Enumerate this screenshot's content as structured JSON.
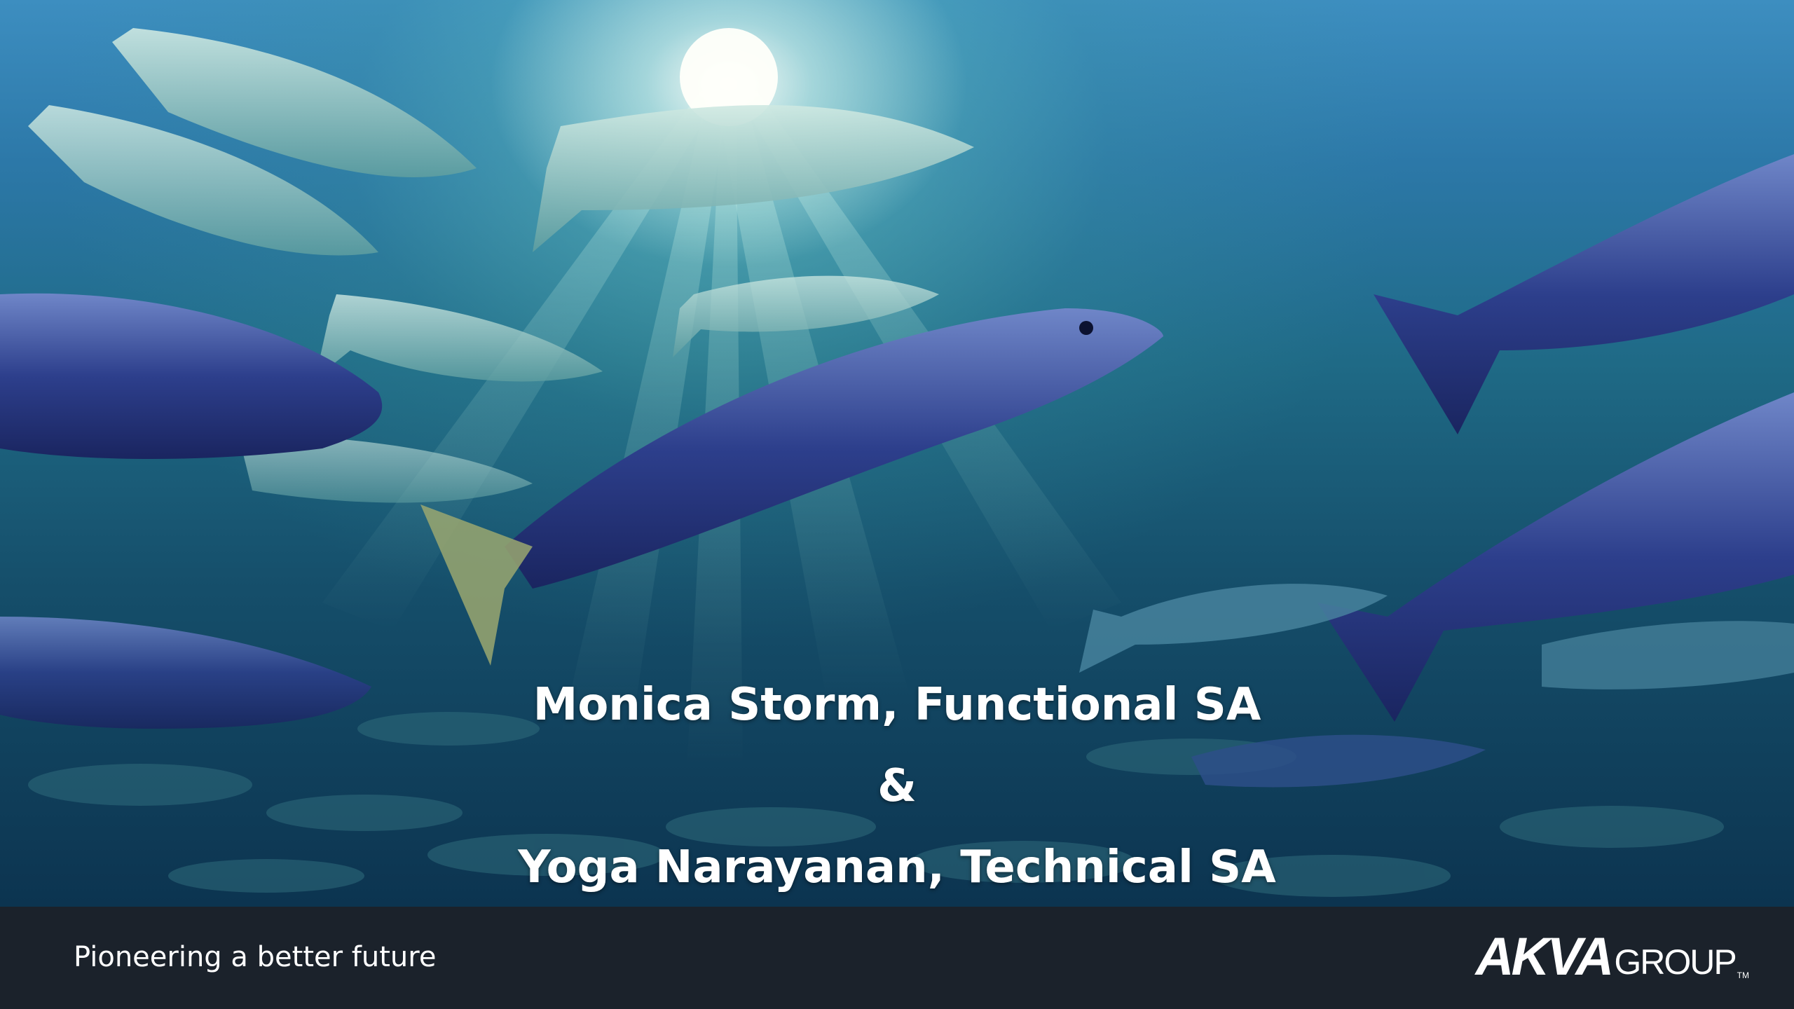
{
  "slide": {
    "title_lines": [
      "Monica Storm, Functional SA",
      "&",
      "Yoga Narayanan, Technical SA"
    ]
  },
  "footer": {
    "tagline": "Pioneering a better future",
    "logo": {
      "akva": "AKVA",
      "group": "GROUP",
      "tm": "TM"
    }
  },
  "colors": {
    "footer_bg": "#1b222b",
    "text": "#ffffff",
    "water_deep": "#0c3450",
    "water_light": "#3d8ec0"
  }
}
